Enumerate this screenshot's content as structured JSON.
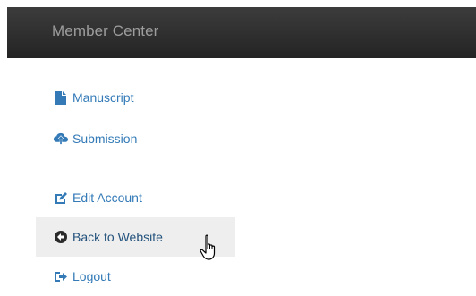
{
  "header": {
    "title": "Member Center"
  },
  "menu": {
    "items": [
      {
        "label": "Manuscript",
        "icon": "file-icon"
      },
      {
        "label": "Submission",
        "icon": "cloud-upload-icon"
      },
      {
        "label": "Edit Account",
        "icon": "edit-icon"
      },
      {
        "label": "Back to Website",
        "icon": "circle-arrow-left-icon"
      },
      {
        "label": "Logout",
        "icon": "logout-icon"
      }
    ]
  },
  "colors": {
    "header_bg": "#2b2b2b",
    "header_text": "#9d9d9d",
    "link": "#337ab7",
    "hover_bg": "#eeeeee"
  }
}
